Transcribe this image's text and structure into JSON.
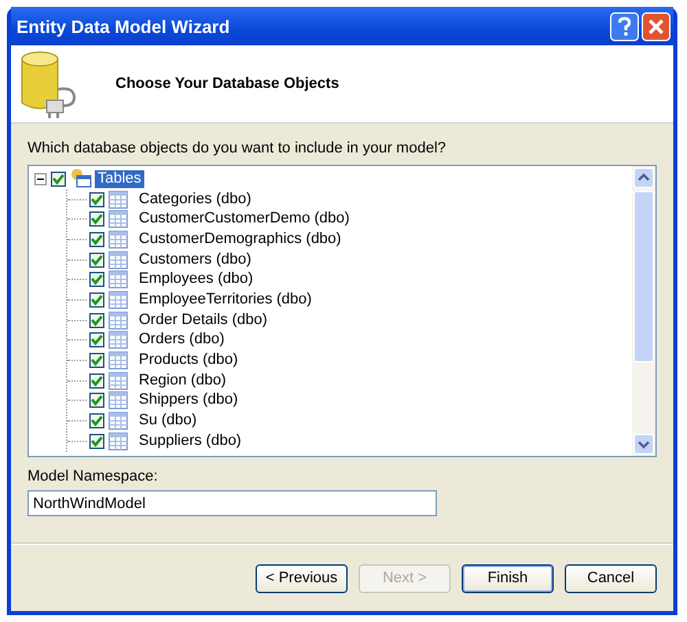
{
  "window": {
    "title": "Entity Data Model Wizard"
  },
  "header": {
    "title": "Choose Your Database Objects"
  },
  "prompt": "Which database objects do you want to include in your model?",
  "tree": {
    "label": "Tables",
    "expanded": true,
    "checked": true,
    "selected": true,
    "children": [
      {
        "label": "Categories (dbo)",
        "checked": true
      },
      {
        "label": "CustomerCustomerDemo (dbo)",
        "checked": true
      },
      {
        "label": "CustomerDemographics (dbo)",
        "checked": true
      },
      {
        "label": "Customers (dbo)",
        "checked": true
      },
      {
        "label": "Employees (dbo)",
        "checked": true
      },
      {
        "label": "EmployeeTerritories (dbo)",
        "checked": true
      },
      {
        "label": "Order Details (dbo)",
        "checked": true
      },
      {
        "label": "Orders (dbo)",
        "checked": true
      },
      {
        "label": "Products (dbo)",
        "checked": true
      },
      {
        "label": "Region (dbo)",
        "checked": true
      },
      {
        "label": "Shippers (dbo)",
        "checked": true
      },
      {
        "label": "Su (dbo)",
        "checked": true
      },
      {
        "label": "Suppliers (dbo)",
        "checked": true
      }
    ]
  },
  "namespace": {
    "label": "Model Namespace:",
    "value": "NorthWindModel"
  },
  "buttons": [
    {
      "label": "< Previous",
      "disabled": false,
      "default": false
    },
    {
      "label": "Next >",
      "disabled": true,
      "default": false
    },
    {
      "label": "Finish",
      "disabled": false,
      "default": true
    },
    {
      "label": "Cancel",
      "disabled": false,
      "default": false
    }
  ]
}
